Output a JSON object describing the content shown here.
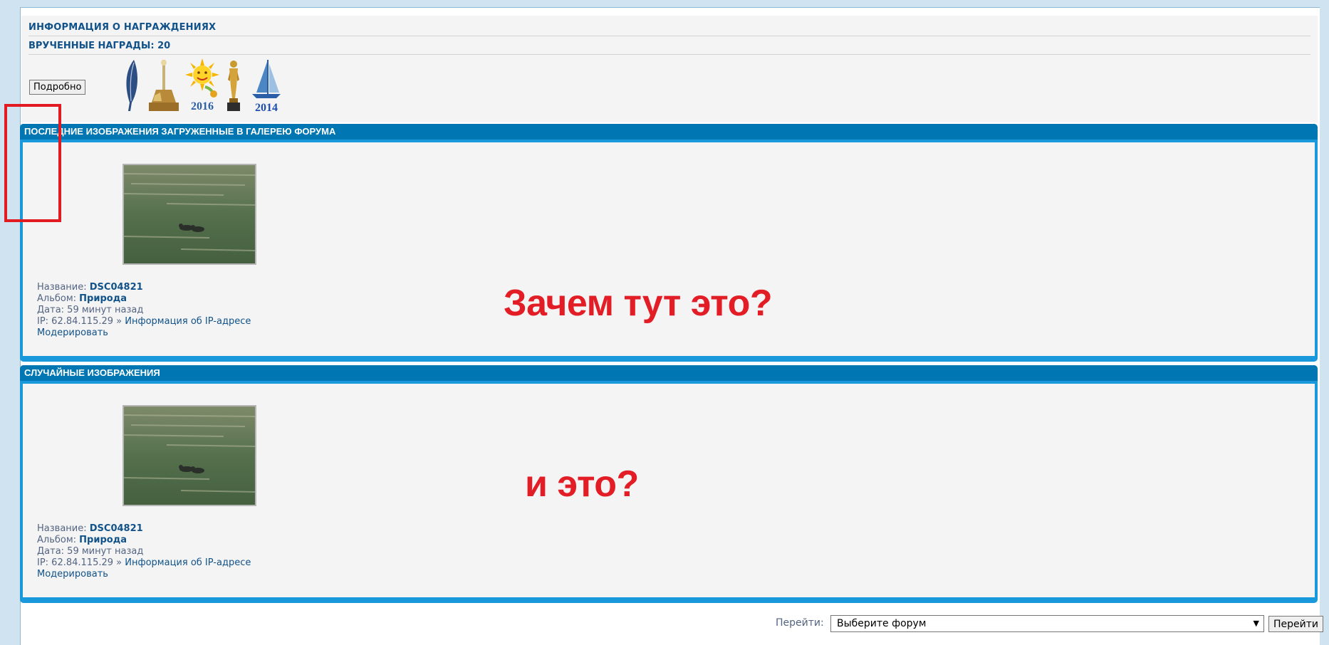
{
  "awards": {
    "title": "ИНФОРМАЦИЯ О НАГРАЖДЕНИЯХ",
    "count_label": "ВРУЧЕННЫЕ НАГРАДЫ: 20",
    "details_button": "Подробно",
    "icons": [
      "feather-award-icon",
      "monument-award-icon",
      "sun-2016-award-icon",
      "oscar-award-icon",
      "sailboat-2014-award-icon"
    ],
    "year_labels": [
      "2016",
      "2014"
    ]
  },
  "recent": {
    "header": "ПОСЛЕДНИЕ ИЗОБРАЖЕНИЯ ЗАГРУЖЕННЫЕ В ГАЛЕРЕЮ ФОРУМА",
    "name_label": "Название:",
    "name_value": "DSC04821",
    "album_label": "Альбом:",
    "album_value": "Природа",
    "date_text": "Дата: 59 минут назад",
    "ip_text": "IP: 62.84.115.29 »",
    "ip_link": "Информация об IP-адресе",
    "moderate_link": "Модерировать",
    "annotation": "Зачем тут это?"
  },
  "random": {
    "header": "СЛУЧАЙНЫЕ ИЗОБРАЖЕНИЯ",
    "name_label": "Название:",
    "name_value": "DSC04821",
    "album_label": "Альбом:",
    "album_value": "Природа",
    "date_text": "Дата: 59 минут назад",
    "ip_text": "IP: 62.84.115.29 »",
    "ip_link": "Информация об IP-адресе",
    "moderate_link": "Модерировать",
    "annotation": "и это?"
  },
  "jump": {
    "label": "Перейти:",
    "selected": "Выберите форум",
    "button": "Перейти"
  },
  "colors": {
    "header_blue": "#0076b3",
    "panel_border": "#1a98dc",
    "link": "#105289",
    "annotation_red": "#e31d25"
  }
}
